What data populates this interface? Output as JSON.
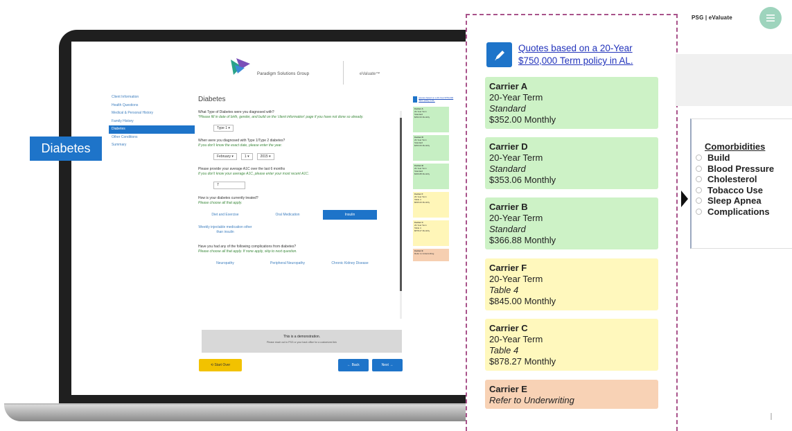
{
  "laptop": {
    "logo_text": "Paradigm Solutions Group",
    "logo_suffix": "eValuate™",
    "nav": [
      "Client Information",
      "Health Questions",
      "Medical & Personal History",
      "Family History",
      "Diabetes",
      "Other Conditions",
      "Summary"
    ],
    "form": {
      "title": "Diabetes",
      "q1": "What Type of Diabetes were you diagnosed with?",
      "q1_hint": "*Please fill in date of birth, gender, and build on the 'client information' page if you have not done so already.",
      "q1_value": "Type 1 ▾",
      "q2": "When were you diagnosed with Type 1/Type 2 diabetes?",
      "q2_hint": "If you don't know the exact date, please enter the year.",
      "q2_month": "February ▾",
      "q2_day": "1 ▾",
      "q2_year": "2015 ▾",
      "q3": "Please provide your average A1C over the last 6 months",
      "q3_hint": "If you don't know your average A1C, please enter your most recent A1C.",
      "q3_value": "7",
      "q4": "How is your diabetes currently treated?",
      "q4_hint": "Please choose all that apply.",
      "q4_choices": [
        "Diet and Exercise",
        "Oral Medication",
        "Insulin"
      ],
      "q4_extra": "Weekly injectable medication other than insulin",
      "q5": "Have you had any of the following complications from diabetes?",
      "q5_hint": "Please choose all that apply. If none apply, skip to next question.",
      "q5_choices": [
        "Neuropathy",
        "Peripheral Neuropathy",
        "Chronic Kidney Disease"
      ],
      "demo_title": "This is a demonstration.",
      "demo_sub": "Please reach out to PSG or your back office for a customized link",
      "start_over": "⟲ Start Over",
      "back": "← Back",
      "next": "Next →"
    },
    "mini": {
      "link": "Quotes based on a 20-Year $750,000 Term policy in AL.",
      "cards": [
        {
          "name": "Carrier A",
          "term": "20-Year Term",
          "tier": "Standard",
          "price": "$352.00 Monthly",
          "color": "g"
        },
        {
          "name": "Carrier D",
          "term": "20-Year Term",
          "tier": "Standard",
          "price": "$353.06 Monthly",
          "color": "g"
        },
        {
          "name": "Carrier B",
          "term": "20-Year Term",
          "tier": "Standard",
          "price": "$366.88 Monthly",
          "color": "g"
        },
        {
          "name": "Carrier F",
          "term": "20-Year Term",
          "tier": "Table 4",
          "price": "$845.00 Monthly",
          "color": "y"
        },
        {
          "name": "Carrier C",
          "term": "20-Year Term",
          "tier": "Table 4",
          "price": "$878.27 Monthly",
          "color": "y"
        },
        {
          "name": "Carrier E",
          "term": "",
          "tier": "Refer to Underwriting",
          "price": "",
          "color": "o"
        }
      ]
    }
  },
  "badge": "Diabetes",
  "quote_panel": {
    "link": [
      "Quotes based on a 20-Year",
      "$750,000 Term policy in AL."
    ],
    "cards": [
      {
        "name": "Carrier A",
        "term": "20-Year Term",
        "tier": "Standard",
        "price": "$352.00 Monthly",
        "color": "green"
      },
      {
        "name": "Carrier D",
        "term": "20-Year Term",
        "tier": "Standard",
        "price": "$353.06 Monthly",
        "color": "green"
      },
      {
        "name": "Carrier B",
        "term": "20-Year Term",
        "tier": "Standard",
        "price": "$366.88 Monthly",
        "color": "green"
      },
      {
        "name": "Carrier F",
        "term": "20-Year Term",
        "tier": "Table 4",
        "price": "$845.00 Monthly",
        "color": "yellow"
      },
      {
        "name": "Carrier C",
        "term": "20-Year Term",
        "tier": "Table 4",
        "price": "$878.27 Monthly",
        "color": "yellow"
      },
      {
        "name": "Carrier E",
        "tier": "Refer to Underwriting",
        "color": "orange"
      }
    ]
  },
  "header": {
    "brand": "PSG | eValuate"
  },
  "comorbidities": {
    "title": "Comorbidities",
    "items": [
      "Build",
      "Blood Pressure",
      "Cholesterol",
      "Tobacco Use",
      "Sleep Apnea",
      "Complications"
    ]
  },
  "colors": {
    "accent": "#1e74c9",
    "green": "#cdf2c6",
    "yellow": "#fff8bd",
    "orange": "#f8d2b5",
    "dash": "#a8528a"
  }
}
